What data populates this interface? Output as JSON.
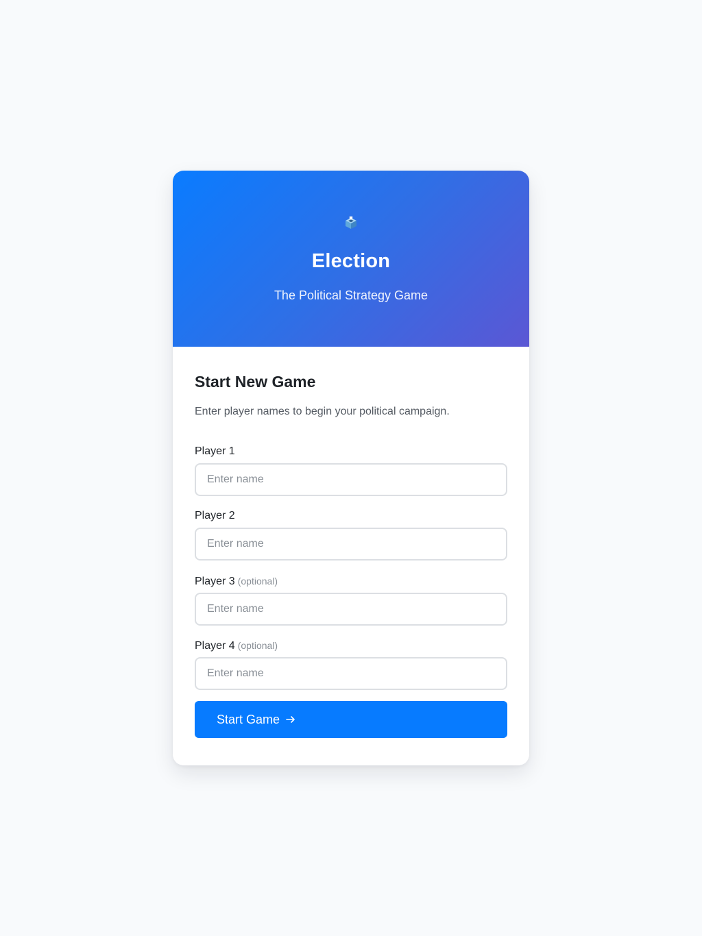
{
  "header": {
    "icon": "ballot-box-icon",
    "title": "Election",
    "subtitle": "The Political Strategy Game",
    "gradient_start": "#0a7cff",
    "gradient_end": "#5b57d4"
  },
  "form": {
    "title": "Start New Game",
    "description": "Enter player names to begin your political campaign.",
    "fields": [
      {
        "label": "Player 1",
        "optional_tag": "",
        "placeholder": "Enter name",
        "value": ""
      },
      {
        "label": "Player 2",
        "optional_tag": "",
        "placeholder": "Enter name",
        "value": ""
      },
      {
        "label": "Player 3",
        "optional_tag": "(optional)",
        "placeholder": "Enter name",
        "value": ""
      },
      {
        "label": "Player 4",
        "optional_tag": "(optional)",
        "placeholder": "Enter name",
        "value": ""
      }
    ],
    "submit_label": "Start Game",
    "submit_icon": "arrow-right-icon",
    "accent_color": "#077bff"
  }
}
